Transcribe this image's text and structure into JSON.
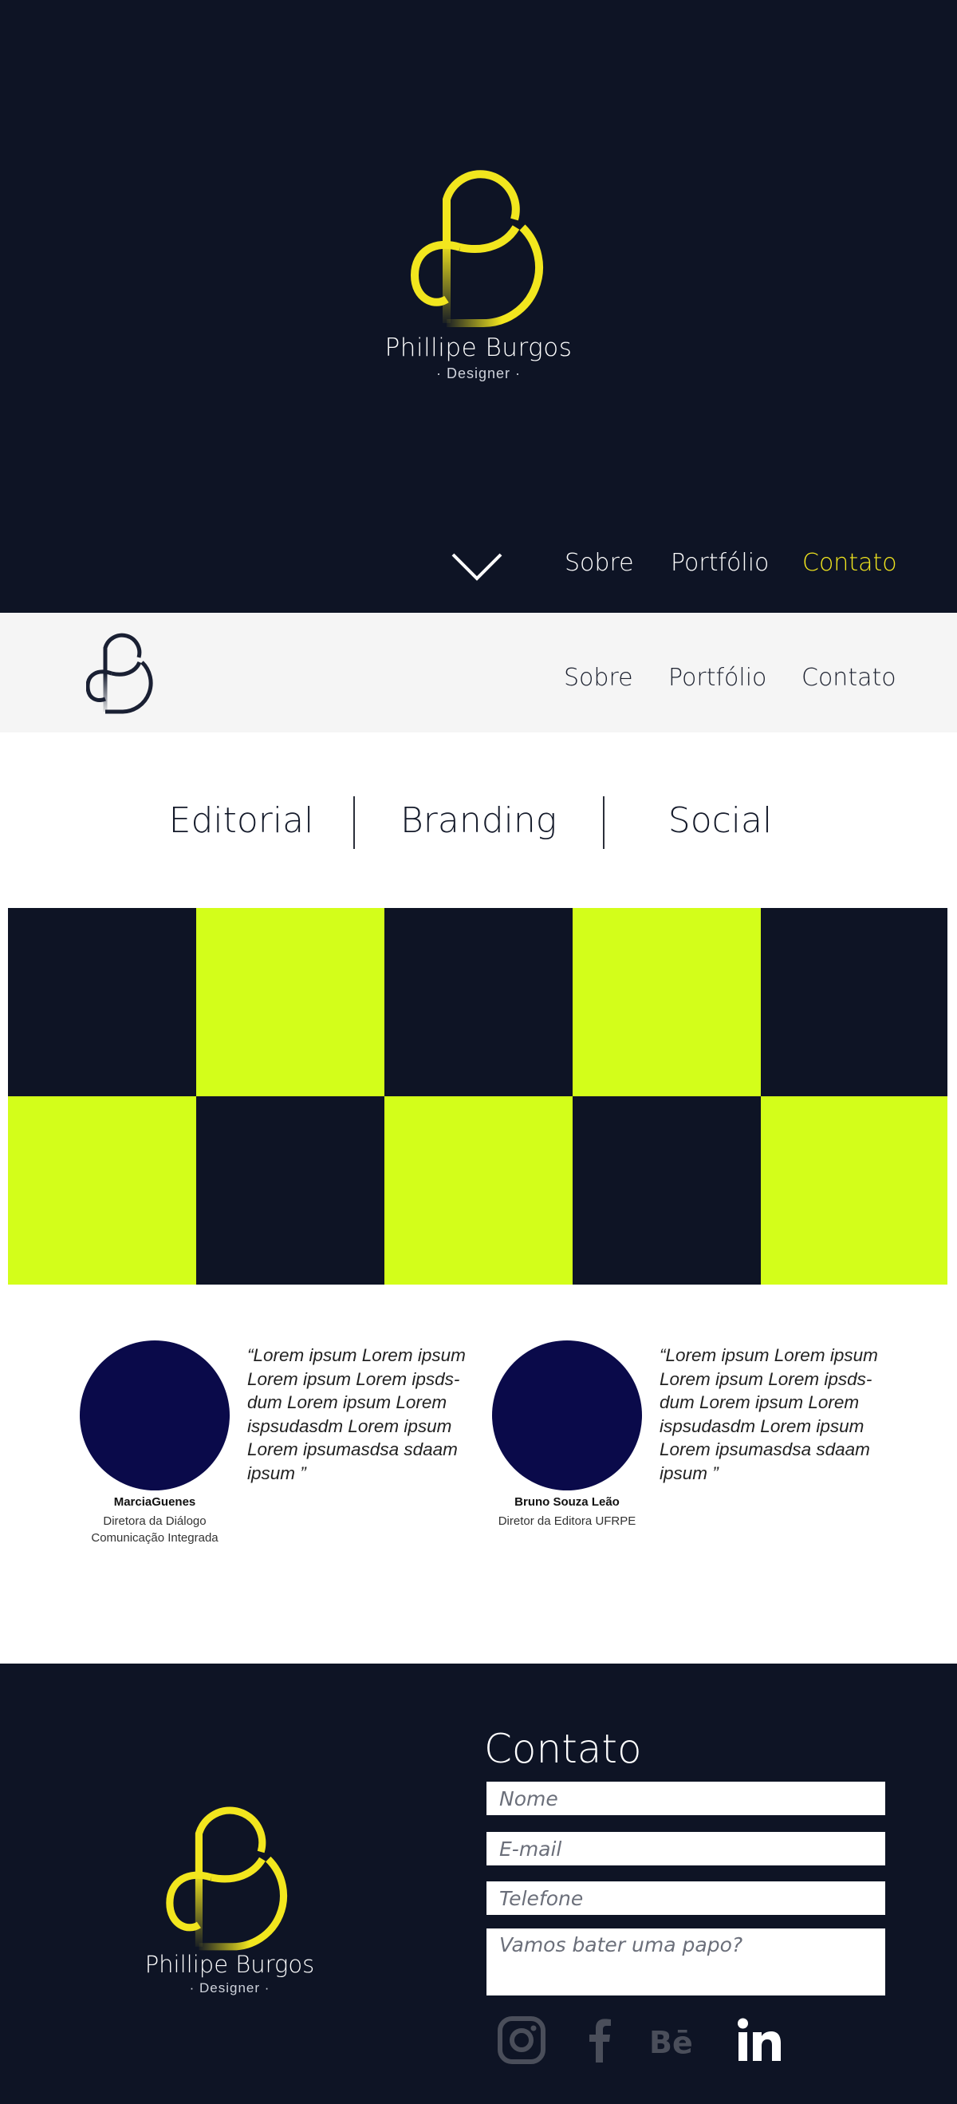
{
  "hero": {
    "name": "Phillipe Burgos",
    "subtitle": "· Designer ·",
    "nav": [
      {
        "label": "Sobre"
      },
      {
        "label": "Portfólio"
      },
      {
        "label": "Contato"
      }
    ],
    "active_nav": "Contato",
    "logo_color": "#f2e61e"
  },
  "header": {
    "nav": [
      {
        "label": "Sobre"
      },
      {
        "label": "Portfólio"
      },
      {
        "label": "Contato"
      }
    ]
  },
  "categories": [
    {
      "label": "Editorial"
    },
    {
      "label": "Branding"
    },
    {
      "label": "Social"
    }
  ],
  "portfolio_grid": {
    "colors": {
      "dark": "#0e1425",
      "lime": "#d3fe1a"
    }
  },
  "testimonials": [
    {
      "quote": "“Lorem ipsum Lorem ipsum Lorem ipsum Lorem ipsds-dum Lorem ipsum Lorem ispsudasdm Lorem ipsum Lorem ipsumasdsa sdaam ipsum ”",
      "name": "MarciaGuenes",
      "role_line1": "Diretora da Diálogo",
      "role_line2": "Comunicação Integrada"
    },
    {
      "quote": "“Lorem ipsum Lorem ipsum Lorem ipsum Lorem ipsds-dum Lorem ipsum Lorem ispsudasdm Lorem ipsum Lorem ipsumasdsa sdaam ipsum ”",
      "name": "Bruno Souza Leão",
      "role_line1": "Diretor da Editora UFRPE"
    }
  ],
  "footer": {
    "name": "Phillipe Burgos",
    "subtitle": "· Designer ·",
    "contact_title": "Contato",
    "fields": {
      "name_placeholder": "Nome",
      "email_placeholder": "E-mail",
      "phone_placeholder": "Telefone",
      "message_placeholder": "Vamos bater uma papo?"
    },
    "social": [
      {
        "icon": "instagram-icon"
      },
      {
        "icon": "facebook-icon"
      },
      {
        "icon": "behance-icon"
      },
      {
        "icon": "linkedin-icon"
      }
    ]
  }
}
